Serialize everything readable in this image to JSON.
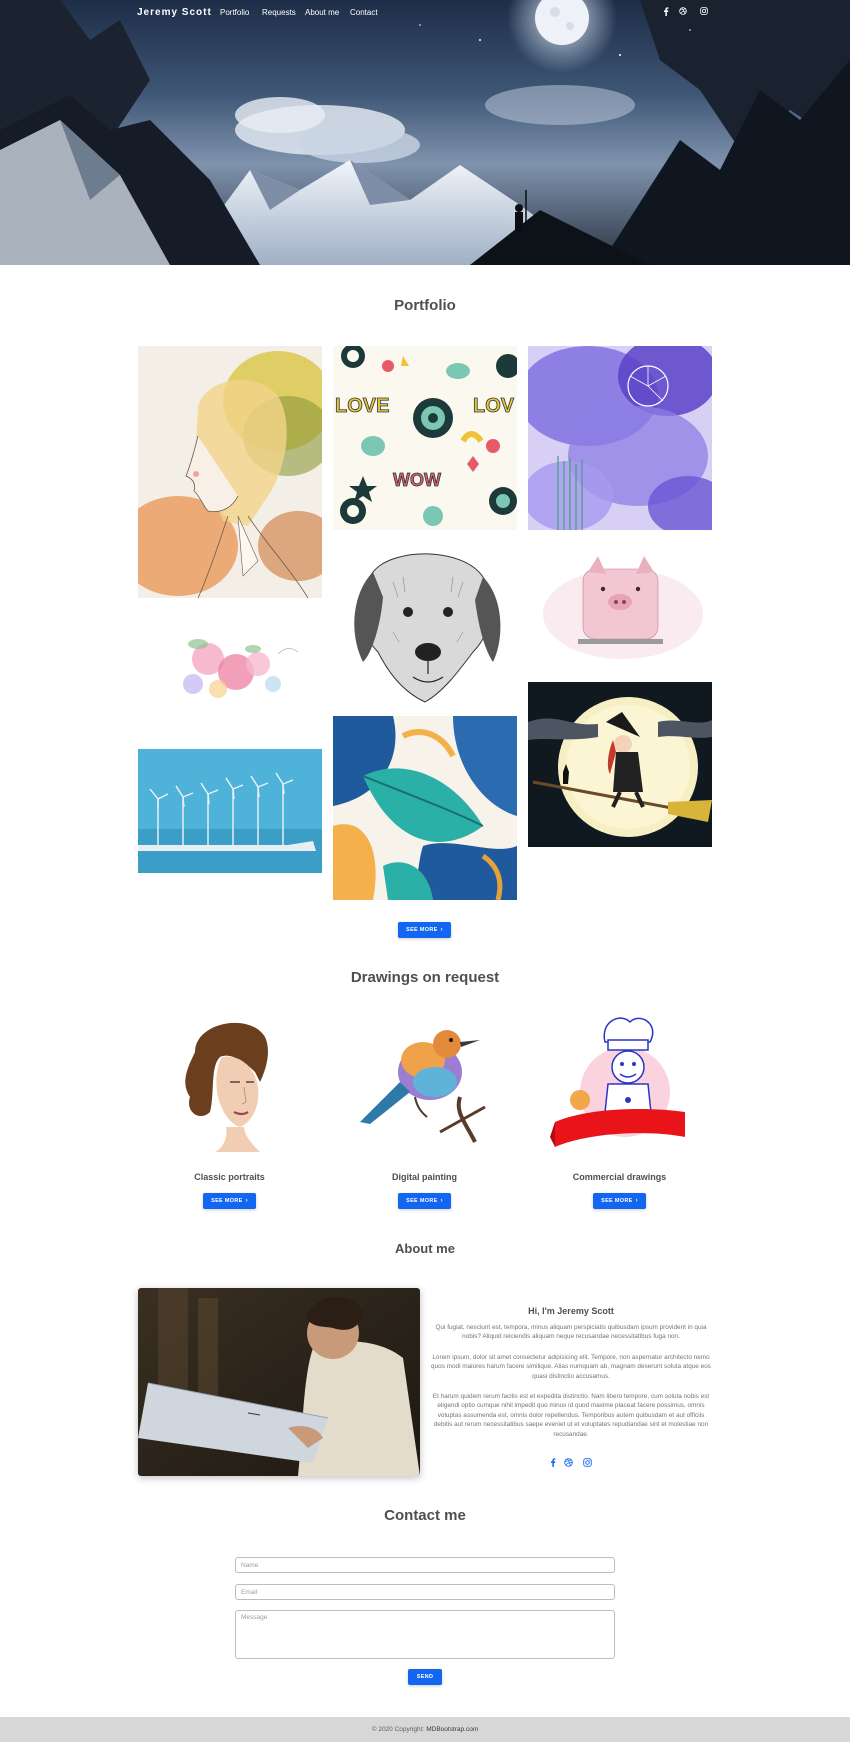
{
  "navbar": {
    "brand": "Jeremy Scott",
    "links": [
      "Portfolio",
      "Requests",
      "About me",
      "Contact"
    ],
    "social_icons": [
      "facebook-icon",
      "dribbble-icon",
      "instagram-icon"
    ]
  },
  "portfolio": {
    "title": "Portfolio",
    "images": [
      "watercolor-woman-portrait",
      "love-pattern",
      "purple-abstract",
      "dog-sketch",
      "pink-pig",
      "watercolor-flowers",
      "wind-turbines",
      "tropical-leaves",
      "witch-on-broom"
    ],
    "see_more": "See more"
  },
  "requests": {
    "title": "Drawings on request",
    "items": [
      {
        "title": "Classic portraits",
        "button": "See more"
      },
      {
        "title": "Digital painting",
        "button": "See more"
      },
      {
        "title": "Commercial drawings",
        "button": "See more"
      }
    ]
  },
  "about": {
    "title": "About me",
    "heading": "Hi, I'm Jeremy Scott",
    "p1": "Qui fugiat, nesciunt est, tempora, minus aliquam perspiciatis quibusdam ipsum provident in quia nobis? Aliquid reiciendis aliquam neque recusandae necessitatibus fuga non.",
    "p2": "Lorem ipsum, dolor sit amet consectetur adipisicing elit. Tempore, non aspernatur architecto nemo quos modi maiores harum facere similique. Alias numquam ab, magnam deserunt soluta atque eos quasi distinctio accusamus.",
    "p3": "Et harum quidem rerum facilis est et expedita distinctio. Nam libero tempore, cum soluta nobis est eligendi optio cumque nihil impedit quo minus id quod maxime placeat facere possimus, omnis voluptas assumenda est, omnis dolor repellendus. Temporibus autem quibusdam et aut officiis debitis aut rerum necessitatibus saepe eveniet ut et voluptates repudiandae sint et molestiae non recusandae.",
    "social_icons": [
      "facebook-icon",
      "dribbble-icon",
      "instagram-icon"
    ]
  },
  "contact": {
    "title": "Contact me",
    "name_placeholder": "Name",
    "email_placeholder": "Email",
    "message_placeholder": "Message",
    "send": "Send"
  },
  "footer": {
    "text": "© 2020 Copyright:",
    "link": "MDBootstrap.com"
  },
  "colors": {
    "primary": "#1266f1",
    "footer_bg": "#d7d7d7",
    "text": "#4f4f4f"
  }
}
